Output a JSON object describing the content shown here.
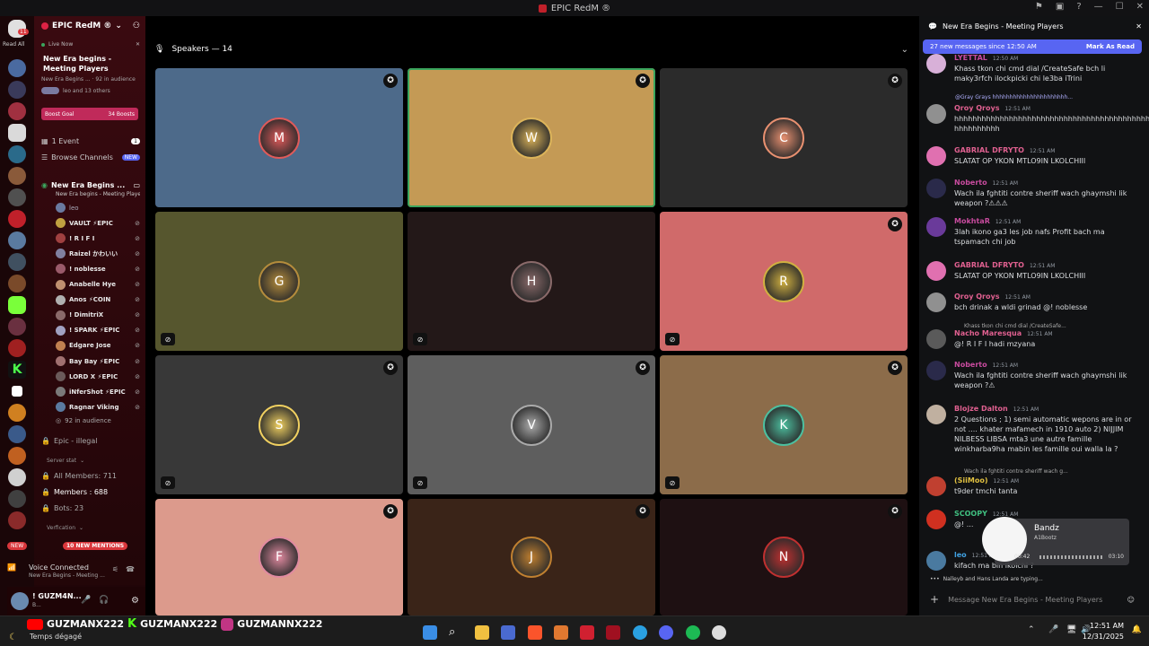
{
  "window": {
    "title": "EPIC RedM ®"
  },
  "servers": {
    "read_all": "Read All",
    "new_badge": "NEW",
    "home_badge": "11"
  },
  "sidebar": {
    "server_name": "EPIC RedM ®",
    "live": {
      "tag": "Live Now",
      "title": "New Era begins - Meeting Players",
      "sub": "New Era Begins ... · 92 in audience",
      "people": "leo and 13 others"
    },
    "boost": {
      "label": "Boost Goal",
      "count": "34 Boosts"
    },
    "event": "1 Event",
    "event_count": "1",
    "browse": "Browse Channels",
    "browse_badge": "NEW",
    "stage": {
      "name": "New Era Begins ...",
      "sub": "New Era begins - Meeting Players"
    },
    "members": [
      "leo",
      "VAULT ⚡EPIC",
      "! R I F I",
      "Raizel かわいい",
      "! noblesse",
      "Anabelle Hye",
      "Anos ⚡COIN",
      "! DimitriX",
      "! SPARK ⚡EPIC",
      "Edgare Jose",
      "Bay Bay ⚡EPIC",
      "LORD X ⚡EPIC",
      "iNferShot ⚡EPIC",
      "Ragnar Viking"
    ],
    "audience": "92 in audience",
    "channels": [
      "Epic - illegal",
      "Server stat",
      "All Members: 711",
      "Members : 688",
      "Bots: 23",
      "Verfication"
    ],
    "mentions": "10 NEW MENTIONS",
    "voice": {
      "status": "Voice Connected",
      "channel": "New Era Begins - Meeting ..."
    },
    "user": {
      "name": "! GUZM4N...",
      "status": "B..."
    }
  },
  "stage_view": {
    "header": "Speakers — 14",
    "tiles": [
      {
        "bg": "#4d6a8a",
        "ring": "#e05a5a",
        "initial": "M",
        "ind": "gear"
      },
      {
        "bg": "#c49a55",
        "ring": "#dcb45a",
        "initial": "W",
        "ind": "gear"
      },
      {
        "bg": "#2b2b2b",
        "ring": "#e89070",
        "initial": "C",
        "ind": "gear"
      },
      {
        "bg": "#56562e",
        "ring": "#b48c3c",
        "initial": "G",
        "ind": "mute"
      },
      {
        "bg": "#231818",
        "ring": "#8a6a6a",
        "initial": "H",
        "ind": "mute"
      },
      {
        "bg": "#d06a6a",
        "ring": "#d0b040",
        "initial": "R",
        "ind": "both"
      },
      {
        "bg": "#383838",
        "ring": "#f0d060",
        "initial": "S",
        "ind": "both"
      },
      {
        "bg": "#5e5e5e",
        "ring": "#aaaaaa",
        "initial": "V",
        "ind": "both"
      },
      {
        "bg": "#8c6c4a",
        "ring": "#4cc0a0",
        "initial": "K",
        "ind": "both"
      },
      {
        "bg": "#dc9a8c",
        "ring": "#e08aa0",
        "initial": "F",
        "ind": "gear"
      },
      {
        "bg": "#3a2418",
        "ring": "#c08030",
        "initial": "J",
        "ind": "gear"
      },
      {
        "bg": "#1e1012",
        "ring": "#c03030",
        "initial": "N",
        "ind": "gear"
      }
    ]
  },
  "chat": {
    "title": "New Era Begins - Meeting Players",
    "new_banner": "27 new messages since 12:50 AM",
    "mark_read": "Mark As Read",
    "messages": [
      {
        "name": "LYETTAL",
        "color": "#c84b9e",
        "time": "12:50 AM",
        "text": "Khass tkon chi cmd dial /CreateSafe bch li maky3rfch ilockpicki chi le3ba iTrini",
        "av": "#d8b0d8"
      },
      {
        "name": "Qroy Qroys",
        "color": "#e06090",
        "time": "12:51 AM",
        "text": "hhhhhhhhhhhhhhhhhhhhhhhhhhhhhhhhhhhhhhhhhhhhhhhhhhhhh hhhhhhhhhh",
        "av": "#909090"
      },
      {
        "name": "GABRIAL DFRYTO",
        "color": "#e06090",
        "time": "12:51 AM",
        "text": "SLATAT OP YKON MTLO9IN LKOLCHIII",
        "av": "#e070b0"
      },
      {
        "name": "Noberto",
        "color": "#c84b9e",
        "time": "12:51 AM",
        "text": "Wach ila fghtiti contre sheriff wach ghaymshi lik weapon ?⚠⚠⚠",
        "av": "#2a2a4a"
      },
      {
        "name": "MokhtaR",
        "color": "#c84b9e",
        "time": "12:51 AM",
        "text": "3lah ikono ga3 les job nafs Profit bach ma tspamach chi job",
        "av": "#6a3a9a"
      },
      {
        "name": "GABRIAL DFRYTO",
        "color": "#e06090",
        "time": "12:51 AM",
        "text": "SLATAT OP YKON MTLO9IN LKOLCHIII",
        "av": "#e070b0"
      },
      {
        "name": "Qroy Qroys",
        "color": "#e06090",
        "time": "12:51 AM",
        "text": "bch drinak a wldi grinad @! noblesse",
        "av": "#909090"
      },
      {
        "name": "Nacho Maresqua",
        "color": "#e06090",
        "time": "12:51 AM",
        "text": "@! R I F I hadi mzyana",
        "av": "#5a5a5a"
      },
      {
        "name": "Noberto",
        "color": "#c84b9e",
        "time": "12:51 AM",
        "text": "Wach ila fghtiti contre sheriff wach ghaymshi lik weapon ?⚠",
        "av": "#2a2a4a"
      },
      {
        "name": "Blojze Dalton",
        "color": "#e06090",
        "time": "12:51 AM",
        "text": "2 Questions ; 1) semi automatic wepons are in or not .... khater mafamech in 1910 auto 2) NIJJIM NILBESS LIBSA mta3 une autre famille winkharba9ha mabin les famille oui walla la ?",
        "av": "#c0b0a0"
      },
      {
        "name": "(SiiMoo)",
        "color": "#e0c040",
        "time": "12:51 AM",
        "text": "t9der tmchi tanta",
        "av": "#c04030"
      },
      {
        "name": "SCOOPY",
        "color": "#40c080",
        "time": "12:51 AM",
        "text": "@! ...",
        "av": "#d03020"
      },
      {
        "name": "leo",
        "color": "#40a0e0",
        "time": "12:51 AM",
        "text": "kifach ma bin lkolchi ?",
        "av": "#4a7aa0"
      }
    ],
    "reply1": "@Gray Grays hhhhhhhhhhhhhhhhhhhhhh...",
    "reply2": "Khass tkon chi cmd dial /CreateSafe...",
    "reply3": "Wach ila fghtiti contre sheriff wach g...",
    "typing": "Nalleyb and Hans Landa are typing...",
    "input_placeholder": "Message New Era Begins - Meeting Players",
    "music": {
      "title": "Bandz",
      "artist": "A1Bootz",
      "elapsed": "00:42",
      "total": "03:10"
    }
  },
  "taskbar": {
    "social": [
      "GUZMANX222",
      "GUZMANX222",
      "GUZMANNX222"
    ],
    "weather": "Temps dégagé",
    "time": "12:51 AM",
    "date": "12/31/2025"
  }
}
